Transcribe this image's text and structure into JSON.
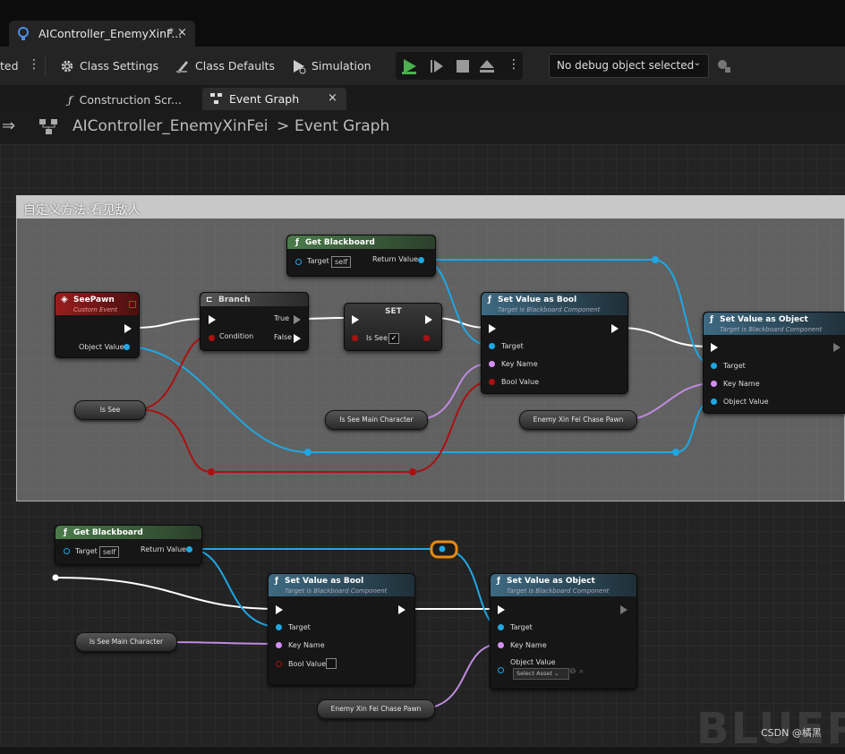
{
  "window": {
    "tab_title": "AIController_EnemyXinF...",
    "tab_modified": "*",
    "tab_close": "×"
  },
  "toolbar": {
    "cut_label": "ted",
    "class_settings": "Class Settings",
    "class_defaults": "Class Defaults",
    "simulation": "Simulation",
    "debug_object": "No debug object selected",
    "colors": {
      "play": "#4cb050"
    }
  },
  "subtabs": {
    "construction": "Construction Scr...",
    "event_graph": "Event Graph",
    "close": "×"
  },
  "breadcrumb": {
    "blueprint": "AIController_EnemyXinFei",
    "separator": ">",
    "graph": "Event Graph"
  },
  "comment": {
    "title": "自定义方法:看见敌人"
  },
  "nodes": {
    "get_bb_1": {
      "title": "Get Blackboard",
      "target": "Target",
      "self": "self",
      "ret": "Return Value"
    },
    "seepawn": {
      "title": "SeePawn",
      "subtitle": "Custom Event",
      "out": "Object Value"
    },
    "branch": {
      "title": "Branch",
      "true": "True",
      "false": "False",
      "cond": "Condition"
    },
    "set": {
      "title": "SET",
      "var": "Is See"
    },
    "svb_1": {
      "title": "Set Value as Bool",
      "subtitle": "Target is Blackboard Component",
      "target": "Target",
      "key": "Key Name",
      "val": "Bool Value"
    },
    "svo_1": {
      "title": "Set Value as Object",
      "subtitle": "Target is Blackboard Component",
      "target": "Target",
      "key": "Key Name",
      "val": "Object Value"
    },
    "var_issee": "Is See",
    "var_ismain_1": "Is See Main Character",
    "var_enemy_1": "Enemy Xin Fei Chase Pawn",
    "get_bb_2": {
      "title": "Get Blackboard",
      "target": "Target",
      "self": "self",
      "ret": "Return Value"
    },
    "svb_2": {
      "title": "Set Value as Bool",
      "subtitle": "Target is Blackboard Component",
      "target": "Target",
      "key": "Key Name",
      "val": "Bool Value"
    },
    "svo_2": {
      "title": "Set Value as Object",
      "subtitle": "Target is Blackboard Component",
      "target": "Target",
      "key": "Key Name",
      "val": "Object Value",
      "asset": "Select Asset"
    },
    "var_ismain_2": "Is See Main Character",
    "var_enemy_2": "Enemy Xin Fei Chase Pawn"
  },
  "watermark": "BLUEP",
  "credit": "CSDN @橘黑",
  "colors": {
    "object_pin": "#1fa7e3",
    "name_pin": "#d58ef5",
    "bool_pin": "#a11111",
    "function_header": "#3a6075",
    "event_header": "#8a1a1a",
    "getter_header": "#3f6b3f"
  }
}
